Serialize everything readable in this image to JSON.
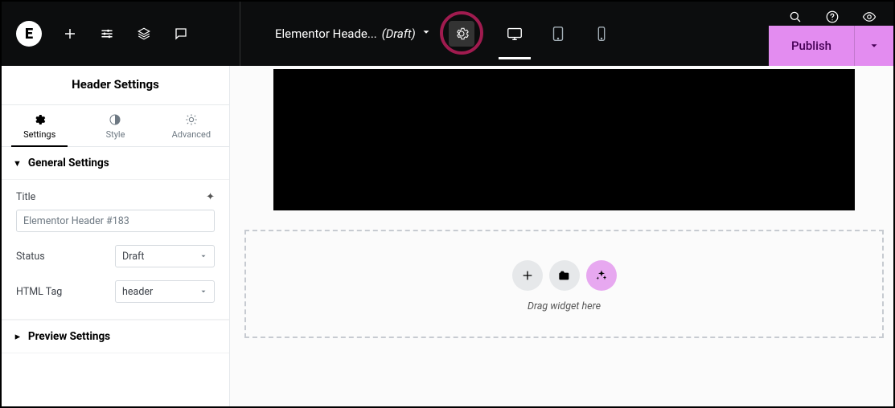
{
  "topbar": {
    "doc_title": "Elementor Heade...",
    "doc_status": "(Draft)",
    "publish_label": "Publish"
  },
  "sidebar": {
    "title": "Header Settings",
    "tabs": {
      "settings": "Settings",
      "style": "Style",
      "advanced": "Advanced"
    },
    "sections": {
      "general": "General Settings",
      "preview": "Preview Settings"
    },
    "controls": {
      "title_label": "Title",
      "title_value": "Elementor Header #183",
      "status_label": "Status",
      "status_value": "Draft",
      "htmltag_label": "HTML Tag",
      "htmltag_value": "header"
    }
  },
  "canvas": {
    "drop_label": "Drag widget here"
  }
}
